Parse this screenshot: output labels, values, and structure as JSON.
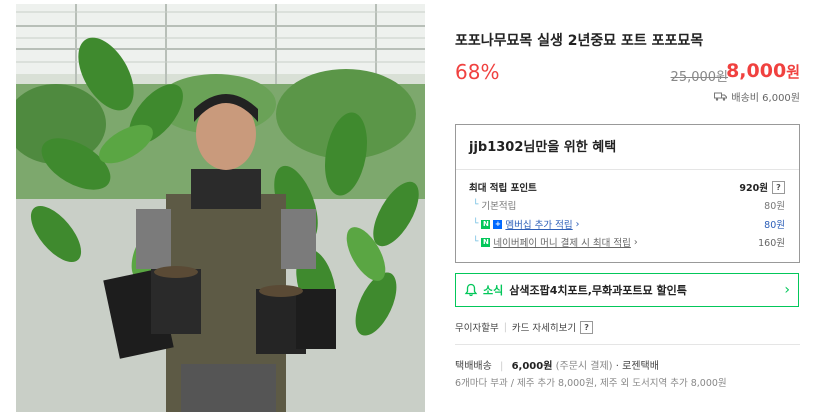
{
  "product": {
    "title": "포포나무묘목 실생 2년중묘 포트 포포묘목",
    "discount": "68%",
    "original_price": "25,000원",
    "price_number": "8,000",
    "price_unit": "원",
    "shipping_fee": "배송비 6,000원"
  },
  "benefit": {
    "heading": "jjb1302님만을 위한 혜택",
    "max_points_label": "최대 적립 포인트",
    "max_points_value": "920원",
    "help_mark": "?",
    "base_label": "기본적립",
    "base_value": "80원",
    "membership_badge": "N",
    "membership_label": "멤버십 추가 적립",
    "membership_value": "80원",
    "npay_badge": "N",
    "npay_label": "네이버페이 머니 결제 시 최대 적립",
    "npay_value": "160원",
    "chevron": "›"
  },
  "news": {
    "tag": "소식",
    "text": "삼색조팝4치포트,무화과포트묘 할인특",
    "chevron": "›"
  },
  "interest": {
    "items": [
      "무이자할부",
      "카드 자세히보기"
    ],
    "help_mark": "?"
  },
  "delivery": {
    "type": "택배배송",
    "fee": "6,000원",
    "fee_note": "(주문시 결제)",
    "carrier": "로젠택배",
    "extra_note": "6개마다 부과 / 제주 추가 8,000원, 제주 외 도서지역 추가 8,000원"
  },
  "colors": {
    "accent_red": "#f0413f",
    "naver_green": "#03c75a",
    "link_blue": "#2d5fb8"
  },
  "icons": [
    "truck-icon",
    "bell-icon",
    "chevron-right-icon",
    "question-icon",
    "naver-plus-icon",
    "naver-pay-icon"
  ]
}
